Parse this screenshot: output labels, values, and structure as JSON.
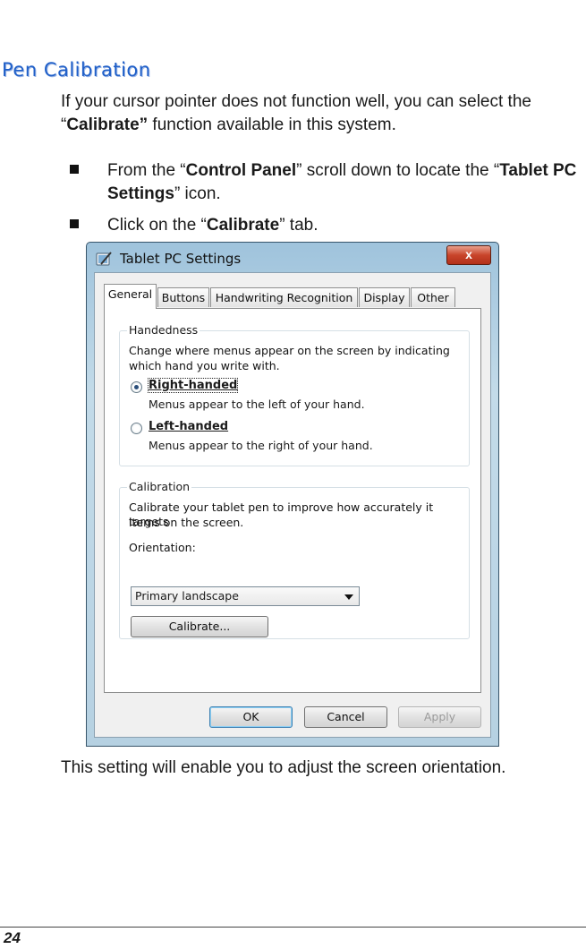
{
  "heading": "Pen Calibration",
  "intro": {
    "pre": "If your cursor pointer does not function well, you can select the “",
    "bold": "Calibrate”",
    "post": " function available in this system."
  },
  "bullets": [
    {
      "pre": "From the “",
      "bold": "Control Panel",
      "mid": "” scroll down to locate the “",
      "bold2": "Tablet PC Settings",
      "post": "” icon."
    },
    {
      "pre": "Click on the “",
      "bold": "Calibrate",
      "post": "” tab."
    }
  ],
  "dialog": {
    "title": "Tablet PC Settings",
    "close": "x",
    "icon": "tablet-pen-icon",
    "tabs": [
      "General",
      "Buttons",
      "Handwriting Recognition",
      "Display",
      "Other"
    ],
    "active_tab": "General",
    "handedness": {
      "title": "Handedness",
      "description_1": "Change where menus appear on the screen by indicating",
      "description_2": "which hand you write with.",
      "right_label": "Right-handed",
      "right_desc": "Menus appear to the left of your hand.",
      "left_label": "Left-handed",
      "left_desc": "Menus appear to the right of your hand.",
      "selected": "Right-handed"
    },
    "calibration": {
      "title": "Calibration",
      "description_1": "Calibrate your tablet pen to improve how accurately it targets",
      "description_2": "items on the screen.",
      "orientation_label": "Orientation:",
      "orientation_value": "Primary landscape",
      "calibrate_button": "Calibrate..."
    },
    "buttons": {
      "ok": "OK",
      "cancel": "Cancel",
      "apply": "Apply"
    }
  },
  "outro": "This setting will enable you to adjust the screen orientation.",
  "page_number": "24",
  "colors": {
    "heading": "#1f5fc8",
    "accent": "#3c7fb1"
  }
}
